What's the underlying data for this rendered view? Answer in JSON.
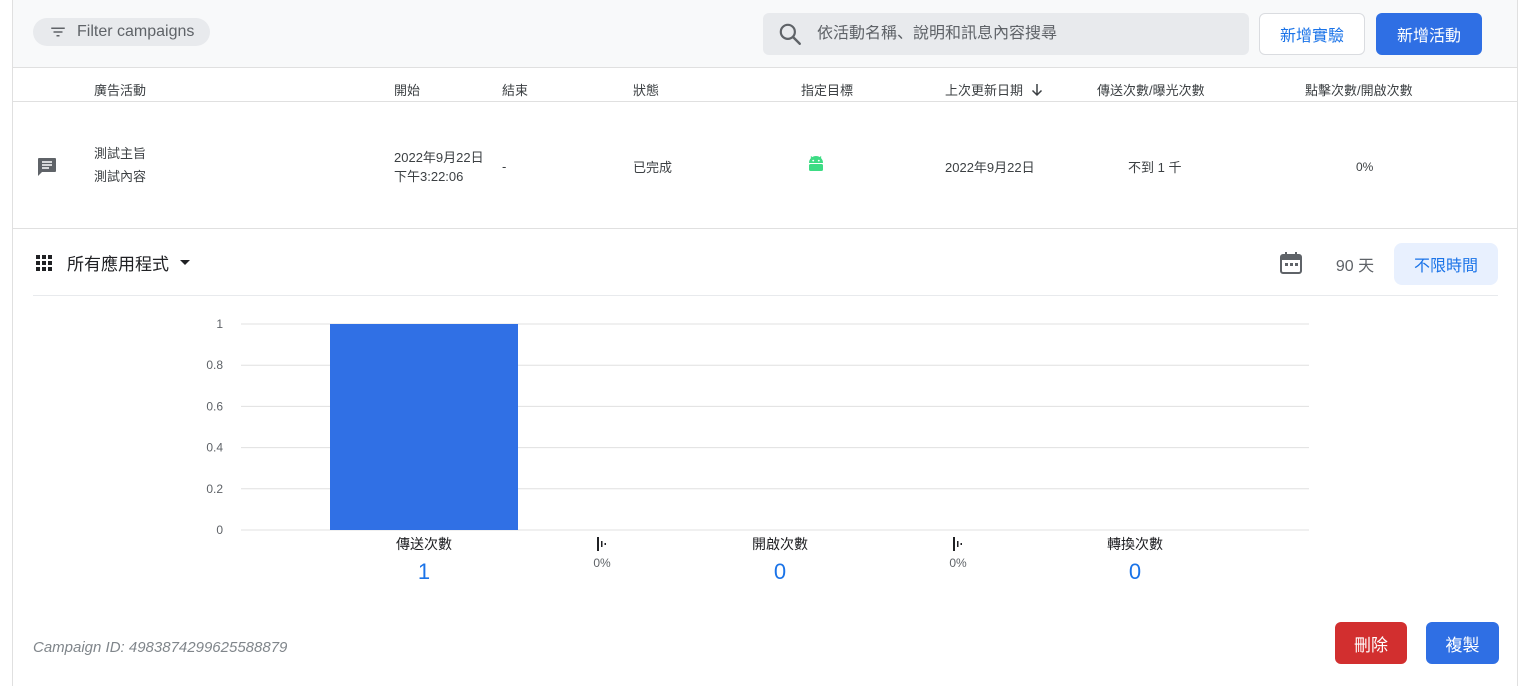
{
  "toolbar": {
    "filter_label": "Filter campaigns",
    "search_placeholder": "依活動名稱、說明和訊息內容搜尋",
    "new_experiment_label": "新增實驗",
    "new_campaign_label": "新增活動"
  },
  "table": {
    "headers": {
      "campaign": "廣告活動",
      "start": "開始",
      "end": "結束",
      "status": "狀態",
      "target": "指定目標",
      "last_updated": "上次更新日期",
      "sends_impressions": "傳送次數/曝光次數",
      "clicks_opens": "點擊次數/開啟次數"
    },
    "row": {
      "title": "測試主旨",
      "content": "測試內容",
      "start_date": "2022年9月22日",
      "start_time": "下午3:22:06",
      "end": "-",
      "status": "已完成",
      "target_icon": "android-icon",
      "last_updated": "2022年9月22日",
      "sends": "不到 1 千",
      "rate": "0%"
    }
  },
  "analytics": {
    "app_selector_label": "所有應用程式",
    "range_90_label": "90 天",
    "range_all_label": "不限時間",
    "campaign_id": "Campaign ID: 4983874299625588879",
    "delete_label": "刪除",
    "copy_label": "複製"
  },
  "colors": {
    "primary": "#2f6fe4",
    "danger": "#d22f2f",
    "bar": "#3070e5",
    "android": "#3ddc84"
  },
  "chart_data": {
    "type": "bar",
    "categories": [
      "傳送次數",
      "開啟次數",
      "轉換次數"
    ],
    "values": [
      1,
      0,
      0
    ],
    "value_labels": [
      "1",
      "0",
      "0"
    ],
    "rates": [
      "0%",
      "0%"
    ],
    "ylim": [
      0,
      1
    ],
    "yticks": [
      "0",
      "0.2",
      "0.4",
      "0.6",
      "0.8",
      "1"
    ],
    "grid": true
  }
}
